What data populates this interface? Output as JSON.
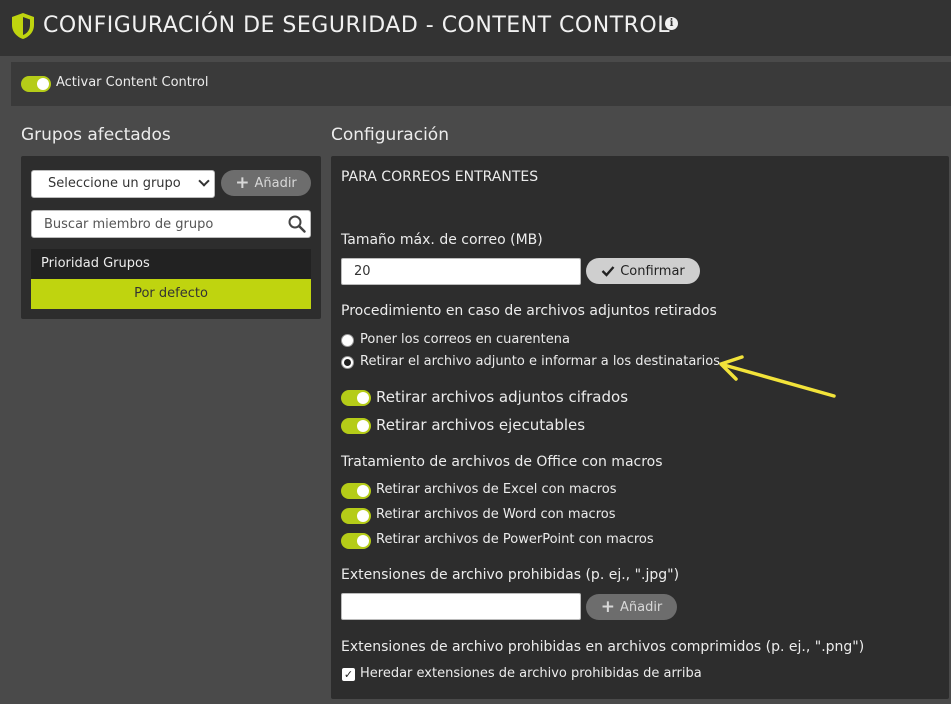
{
  "header": {
    "title": "CONFIGURACIÓN DE SEGURIDAD - CONTENT CONTROL",
    "info_glyph": "i"
  },
  "activate": {
    "label": "Activar Content Control",
    "enabled": true
  },
  "groups": {
    "title": "Grupos afectados",
    "select_value": "Seleccione un grupo",
    "add_label": "Añadir",
    "search_placeholder": "Buscar miembro de grupo",
    "priority_header": "Prioridad Grupos",
    "rows": [
      "Por defecto"
    ]
  },
  "config": {
    "title": "Configuración",
    "section_incoming": "PARA CORREOS ENTRANTES",
    "max_size_label": "Tamaño máx. de correo (MB)",
    "max_size_value": "20",
    "confirm_label": "Confirmar",
    "procedure_label": "Procedimiento en caso de archivos adjuntos retirados",
    "radio_options": [
      {
        "label": "Poner los correos en cuarentena",
        "selected": false
      },
      {
        "label": "Retirar el archivo adjunto e informar a los destinatarios",
        "selected": true
      }
    ],
    "toggles_main": [
      {
        "label": "Retirar archivos adjuntos cifrados",
        "on": true
      },
      {
        "label": "Retirar archivos ejecutables",
        "on": true
      }
    ],
    "office_label": "Tratamiento de archivos de Office con macros",
    "toggles_office": [
      {
        "label": "Retirar archivos de Excel con macros",
        "on": true
      },
      {
        "label": "Retirar archivos de Word con macros",
        "on": true
      },
      {
        "label": "Retirar archivos de PowerPoint con macros",
        "on": true
      }
    ],
    "forbidden_ext_label": "Extensiones de archivo prohibidas (p. ej., \".jpg\")",
    "forbidden_ext_value": "",
    "add_label": "Añadir",
    "forbidden_compressed_label": "Extensiones de archivo prohibidas en archivos comprimidos (p. ej., \".png\")",
    "inherit_label": "Heredar extensiones de archivo prohibidas de arriba",
    "inherit_checked": true
  },
  "colors": {
    "accent": "#bfd40f",
    "panel": "#2d2d2d",
    "header": "#333333",
    "annotation_arrow": "#f2e33a"
  }
}
